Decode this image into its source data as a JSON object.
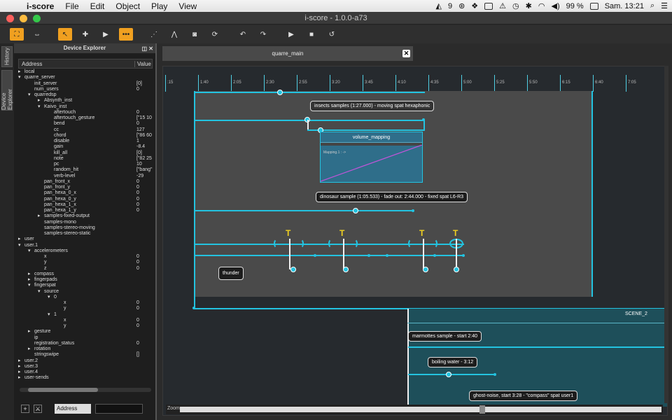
{
  "menubar": {
    "app_name": "i-score",
    "items": [
      "File",
      "Edit",
      "Object",
      "Play",
      "View"
    ],
    "status_a9": "9",
    "battery": "99 %",
    "clock": "Sam. 13:21"
  },
  "window": {
    "title": "i-score - 1.0.0-a73"
  },
  "toolbar": {
    "buttons": [
      "select-tool",
      "create-tool",
      "play-tool",
      "sequence-tool",
      "move-slot",
      "curve-tool",
      "snapshot-tool",
      "refresh-tool",
      "undo",
      "redo",
      "play",
      "stop",
      "reinit"
    ]
  },
  "left_tabs": {
    "history": "History",
    "device_explorer": "Device Explorer"
  },
  "device_explorer": {
    "title": "Device Explorer",
    "col_address": "Address",
    "col_value": "Value",
    "tree": [
      {
        "indent": 0,
        "arrow": "▸",
        "name": "local",
        "value": ""
      },
      {
        "indent": 0,
        "arrow": "▾",
        "name": "quarre_server",
        "value": ""
      },
      {
        "indent": 1,
        "arrow": "",
        "name": "init_server",
        "value": "[0]"
      },
      {
        "indent": 1,
        "arrow": "",
        "name": "num_users",
        "value": "0"
      },
      {
        "indent": 1,
        "arrow": "▾",
        "name": "quarredsp",
        "value": ""
      },
      {
        "indent": 2,
        "arrow": "▸",
        "name": "Absynth_inst",
        "value": ""
      },
      {
        "indent": 2,
        "arrow": "▾",
        "name": "Kaivo_inst",
        "value": ""
      },
      {
        "indent": 3,
        "arrow": "",
        "name": "aftertouch",
        "value": "0"
      },
      {
        "indent": 3,
        "arrow": "",
        "name": "aftertouch_gesture",
        "value": "[\"15 10"
      },
      {
        "indent": 3,
        "arrow": "",
        "name": "bend",
        "value": "0"
      },
      {
        "indent": 3,
        "arrow": "",
        "name": "cc",
        "value": "127"
      },
      {
        "indent": 3,
        "arrow": "",
        "name": "chord",
        "value": "[\"86 60"
      },
      {
        "indent": 3,
        "arrow": "",
        "name": "disable",
        "value": "1"
      },
      {
        "indent": 3,
        "arrow": "",
        "name": "gain",
        "value": "-8.4"
      },
      {
        "indent": 3,
        "arrow": "",
        "name": "kill_all",
        "value": "[0]"
      },
      {
        "indent": 3,
        "arrow": "",
        "name": "note",
        "value": "[\"82 25"
      },
      {
        "indent": 3,
        "arrow": "",
        "name": "pc",
        "value": "10"
      },
      {
        "indent": 3,
        "arrow": "",
        "name": "random_hit",
        "value": "[\"bang\""
      },
      {
        "indent": 3,
        "arrow": "",
        "name": "verb-level",
        "value": "-29"
      },
      {
        "indent": 2,
        "arrow": "",
        "name": "pan_front_x",
        "value": "0"
      },
      {
        "indent": 2,
        "arrow": "",
        "name": "pan_front_y",
        "value": "0"
      },
      {
        "indent": 2,
        "arrow": "",
        "name": "pan_hexa_0_x",
        "value": "0"
      },
      {
        "indent": 2,
        "arrow": "",
        "name": "pan_hexa_0_y",
        "value": "0"
      },
      {
        "indent": 2,
        "arrow": "",
        "name": "pan_hexa_1_x",
        "value": "0"
      },
      {
        "indent": 2,
        "arrow": "",
        "name": "pan_hexa_1_y",
        "value": "0"
      },
      {
        "indent": 2,
        "arrow": "▸",
        "name": "samples-fixed-output",
        "value": ""
      },
      {
        "indent": 2,
        "arrow": "",
        "name": "samples-mono",
        "value": ""
      },
      {
        "indent": 2,
        "arrow": "",
        "name": "samples-stereo-moving",
        "value": ""
      },
      {
        "indent": 2,
        "arrow": "",
        "name": "samples-stereo-static",
        "value": ""
      },
      {
        "indent": 0,
        "arrow": "▸",
        "name": "user",
        "value": ""
      },
      {
        "indent": 0,
        "arrow": "▾",
        "name": "user.1",
        "value": ""
      },
      {
        "indent": 1,
        "arrow": "▾",
        "name": "accelerometers",
        "value": ""
      },
      {
        "indent": 2,
        "arrow": "",
        "name": "x",
        "value": "0"
      },
      {
        "indent": 2,
        "arrow": "",
        "name": "y",
        "value": "0"
      },
      {
        "indent": 2,
        "arrow": "",
        "name": "z",
        "value": "0"
      },
      {
        "indent": 1,
        "arrow": "▸",
        "name": "compass",
        "value": ""
      },
      {
        "indent": 1,
        "arrow": "▸",
        "name": "fingerpads",
        "value": ""
      },
      {
        "indent": 1,
        "arrow": "▾",
        "name": "fingerspat",
        "value": ""
      },
      {
        "indent": 2,
        "arrow": "▾",
        "name": "source",
        "value": ""
      },
      {
        "indent": 3,
        "arrow": "▾",
        "name": "0",
        "value": ""
      },
      {
        "indent": 4,
        "arrow": "",
        "name": "x",
        "value": "0"
      },
      {
        "indent": 4,
        "arrow": "",
        "name": "y",
        "value": "0"
      },
      {
        "indent": 3,
        "arrow": "▾",
        "name": "1",
        "value": ""
      },
      {
        "indent": 4,
        "arrow": "",
        "name": "x",
        "value": "0"
      },
      {
        "indent": 4,
        "arrow": "",
        "name": "y",
        "value": "0"
      },
      {
        "indent": 1,
        "arrow": "▸",
        "name": "gesture",
        "value": ""
      },
      {
        "indent": 1,
        "arrow": "",
        "name": "ip",
        "value": ""
      },
      {
        "indent": 1,
        "arrow": "",
        "name": "registration_status",
        "value": "0"
      },
      {
        "indent": 1,
        "arrow": "▸",
        "name": "rotation",
        "value": ""
      },
      {
        "indent": 1,
        "arrow": "",
        "name": "stringswipe",
        "value": "[]"
      },
      {
        "indent": 0,
        "arrow": "▸",
        "name": "user.2",
        "value": ""
      },
      {
        "indent": 0,
        "arrow": "▸",
        "name": "user.3",
        "value": ""
      },
      {
        "indent": 0,
        "arrow": "▸",
        "name": "user.4",
        "value": ""
      },
      {
        "indent": 0,
        "arrow": "▸",
        "name": "user-sends",
        "value": ""
      }
    ],
    "footer_select": "Address"
  },
  "main_tab": {
    "label": "quarre_main"
  },
  "timeline": {
    "ticks": [
      ":15",
      "1:40",
      "2:05",
      "2:30",
      "2:55",
      "3:20",
      "3:45",
      "4:10",
      "4:35",
      "5:00",
      "5:25",
      "5:50",
      "6:15",
      "6:40",
      "7:05"
    ]
  },
  "boxes": {
    "insects": "insects samples (1:27.000) - moving spat hexaphonic",
    "volume_mapping": "volume_mapping",
    "mapping_label": "Mapping.1 :    ->",
    "dinosaur": "dinosaur sample (1:05.533) - fade out: 2:44.000 - fixed spat L6-R3",
    "thunder": "thunder",
    "scene2": "SCENE_2",
    "marmottes": "marmottes sample - start 2:40",
    "boiling": "boiling water - 3:12",
    "ghost": "ghost-noise, start 3:28 - \"compass\" spat user1"
  },
  "zoom_label": "Zoom",
  "colors": {
    "accent": "#23c3e0",
    "toolbar_active": "#f0a020",
    "trigger": "#f0d020",
    "scene2_bg": "#1e4f5a"
  }
}
